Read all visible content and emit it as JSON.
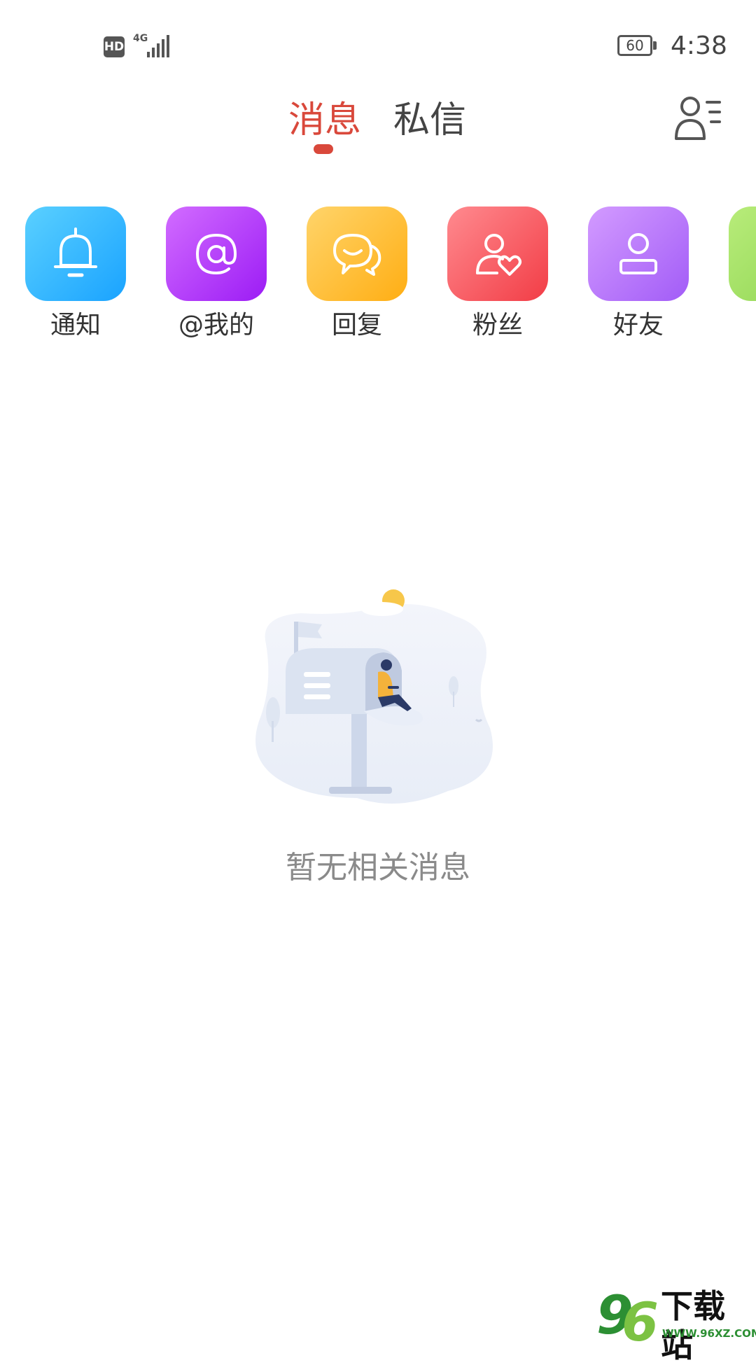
{
  "status_bar": {
    "hd": "HD",
    "network": "4G",
    "battery": "60",
    "time": "4:38"
  },
  "header": {
    "tabs": [
      {
        "label": "消息",
        "active": true
      },
      {
        "label": "私信",
        "active": false
      }
    ],
    "contacts_icon": "contacts-list-icon"
  },
  "categories": [
    {
      "label": "通知",
      "icon": "bell-icon",
      "color": "#1aa3ff"
    },
    {
      "label": "@我的",
      "icon": "at-icon",
      "color": "#9c1cf5"
    },
    {
      "label": "回复",
      "icon": "chat-bubbles-icon",
      "color": "#ffae14"
    },
    {
      "label": "粉丝",
      "icon": "user-heart-icon",
      "color": "#f23d46"
    },
    {
      "label": "好友",
      "icon": "user-icon",
      "color": "#a25cf7"
    },
    {
      "label": "",
      "icon": "partial-icon",
      "color": "#8fd552"
    }
  ],
  "empty_state": {
    "message": "暂无相关消息",
    "illustration": "mailbox-illustration"
  },
  "watermark": {
    "logo_digits": "96",
    "name": "下载站",
    "url": "WWW.96XZ.COM"
  },
  "colors": {
    "accent": "#d9483b",
    "text_primary": "#333333",
    "text_muted": "#8a8a8a"
  }
}
